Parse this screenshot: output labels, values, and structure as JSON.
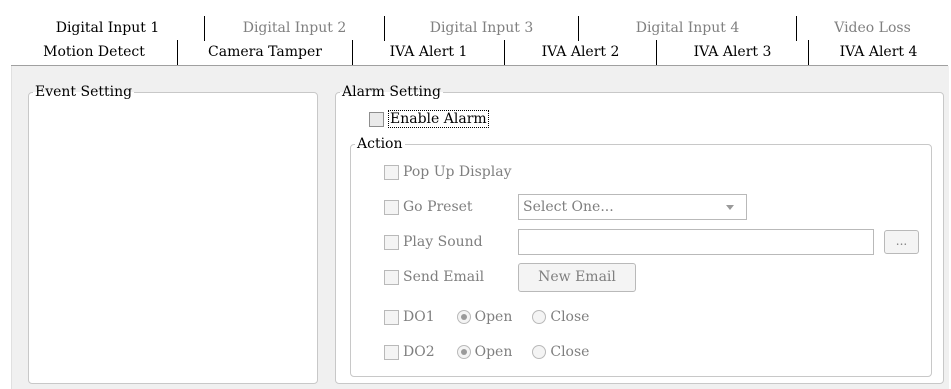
{
  "tabs_back": [
    "Digital Input 1",
    "Digital Input 2",
    "Digital Input 3",
    "Digital Input 4",
    "Video Loss"
  ],
  "tabs_front": [
    "Motion Detect",
    "Camera Tamper",
    "IVA Alert 1",
    "IVA Alert 2",
    "IVA Alert 3",
    "IVA Alert 4"
  ],
  "active_tab": "Motion Detect",
  "event_setting": {
    "title": "Event Setting"
  },
  "alarm_setting": {
    "title": "Alarm Setting",
    "enable_alarm": {
      "label": "Enable Alarm",
      "checked": false
    },
    "action": {
      "title": "Action",
      "popup": {
        "label": "Pop Up Display",
        "checked": false
      },
      "go_preset": {
        "label": "Go Preset",
        "checked": false,
        "select_value": "Select One..."
      },
      "play_sound": {
        "label": "Play Sound",
        "checked": false,
        "value": "",
        "browse_label": "..."
      },
      "send_email": {
        "label": "Send Email",
        "checked": false,
        "button_label": "New Email"
      },
      "do1": {
        "label": "DO1",
        "checked": false,
        "open_label": "Open",
        "close_label": "Close",
        "selected": "Open"
      },
      "do2": {
        "label": "DO2",
        "checked": false,
        "open_label": "Open",
        "close_label": "Close",
        "selected": "Open"
      }
    }
  }
}
